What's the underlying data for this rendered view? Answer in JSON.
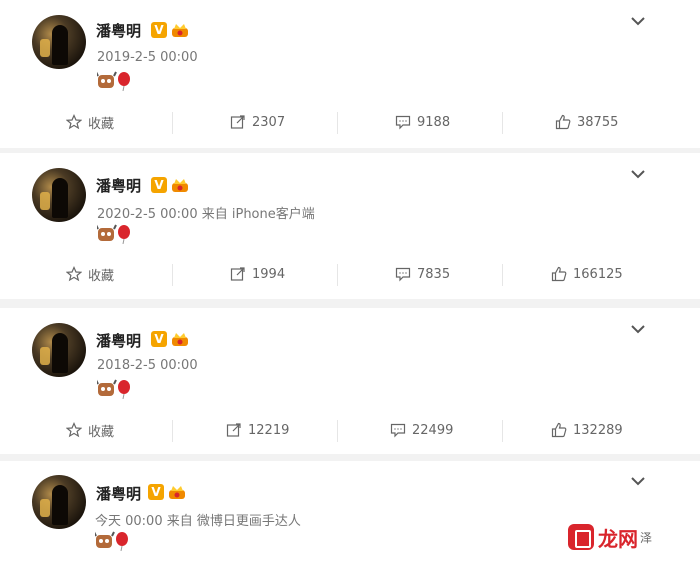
{
  "posts": [
    {
      "user": "潘粤明",
      "verified_mark": "V",
      "timestamp": "2019-2-5 00:00",
      "reactions": [
        "cow-emoji",
        "balloon-emoji"
      ],
      "actions": {
        "favorite": "收藏",
        "repost": "2307",
        "comment": "9188",
        "like": "38755"
      }
    },
    {
      "user": "潘粤明",
      "verified_mark": "V",
      "timestamp": "2020-2-5 00:00 来自 iPhone客户端",
      "reactions": [
        "cow-emoji",
        "balloon-emoji"
      ],
      "actions": {
        "favorite": "收藏",
        "repost": "1994",
        "comment": "7835",
        "like": "166125"
      }
    },
    {
      "user": "潘粤明",
      "verified_mark": "V",
      "timestamp": "2018-2-5 00:00",
      "reactions": [
        "cow-emoji",
        "balloon-emoji"
      ],
      "actions": {
        "favorite": "收藏",
        "repost": "12219",
        "comment": "22499",
        "like": "132289"
      }
    },
    {
      "user": "潘粤明",
      "verified_mark": "V",
      "timestamp": "今天 00:00 来自 微博日更画手达人",
      "reactions": [
        "cow-emoji",
        "balloon-emoji"
      ]
    }
  ],
  "watermark": {
    "brand": "龙网",
    "suffix": "泽"
  },
  "colors": {
    "background": "#f2f2f2",
    "card": "#ffffff",
    "verified": "#f5a400",
    "text_muted": "#777777"
  }
}
